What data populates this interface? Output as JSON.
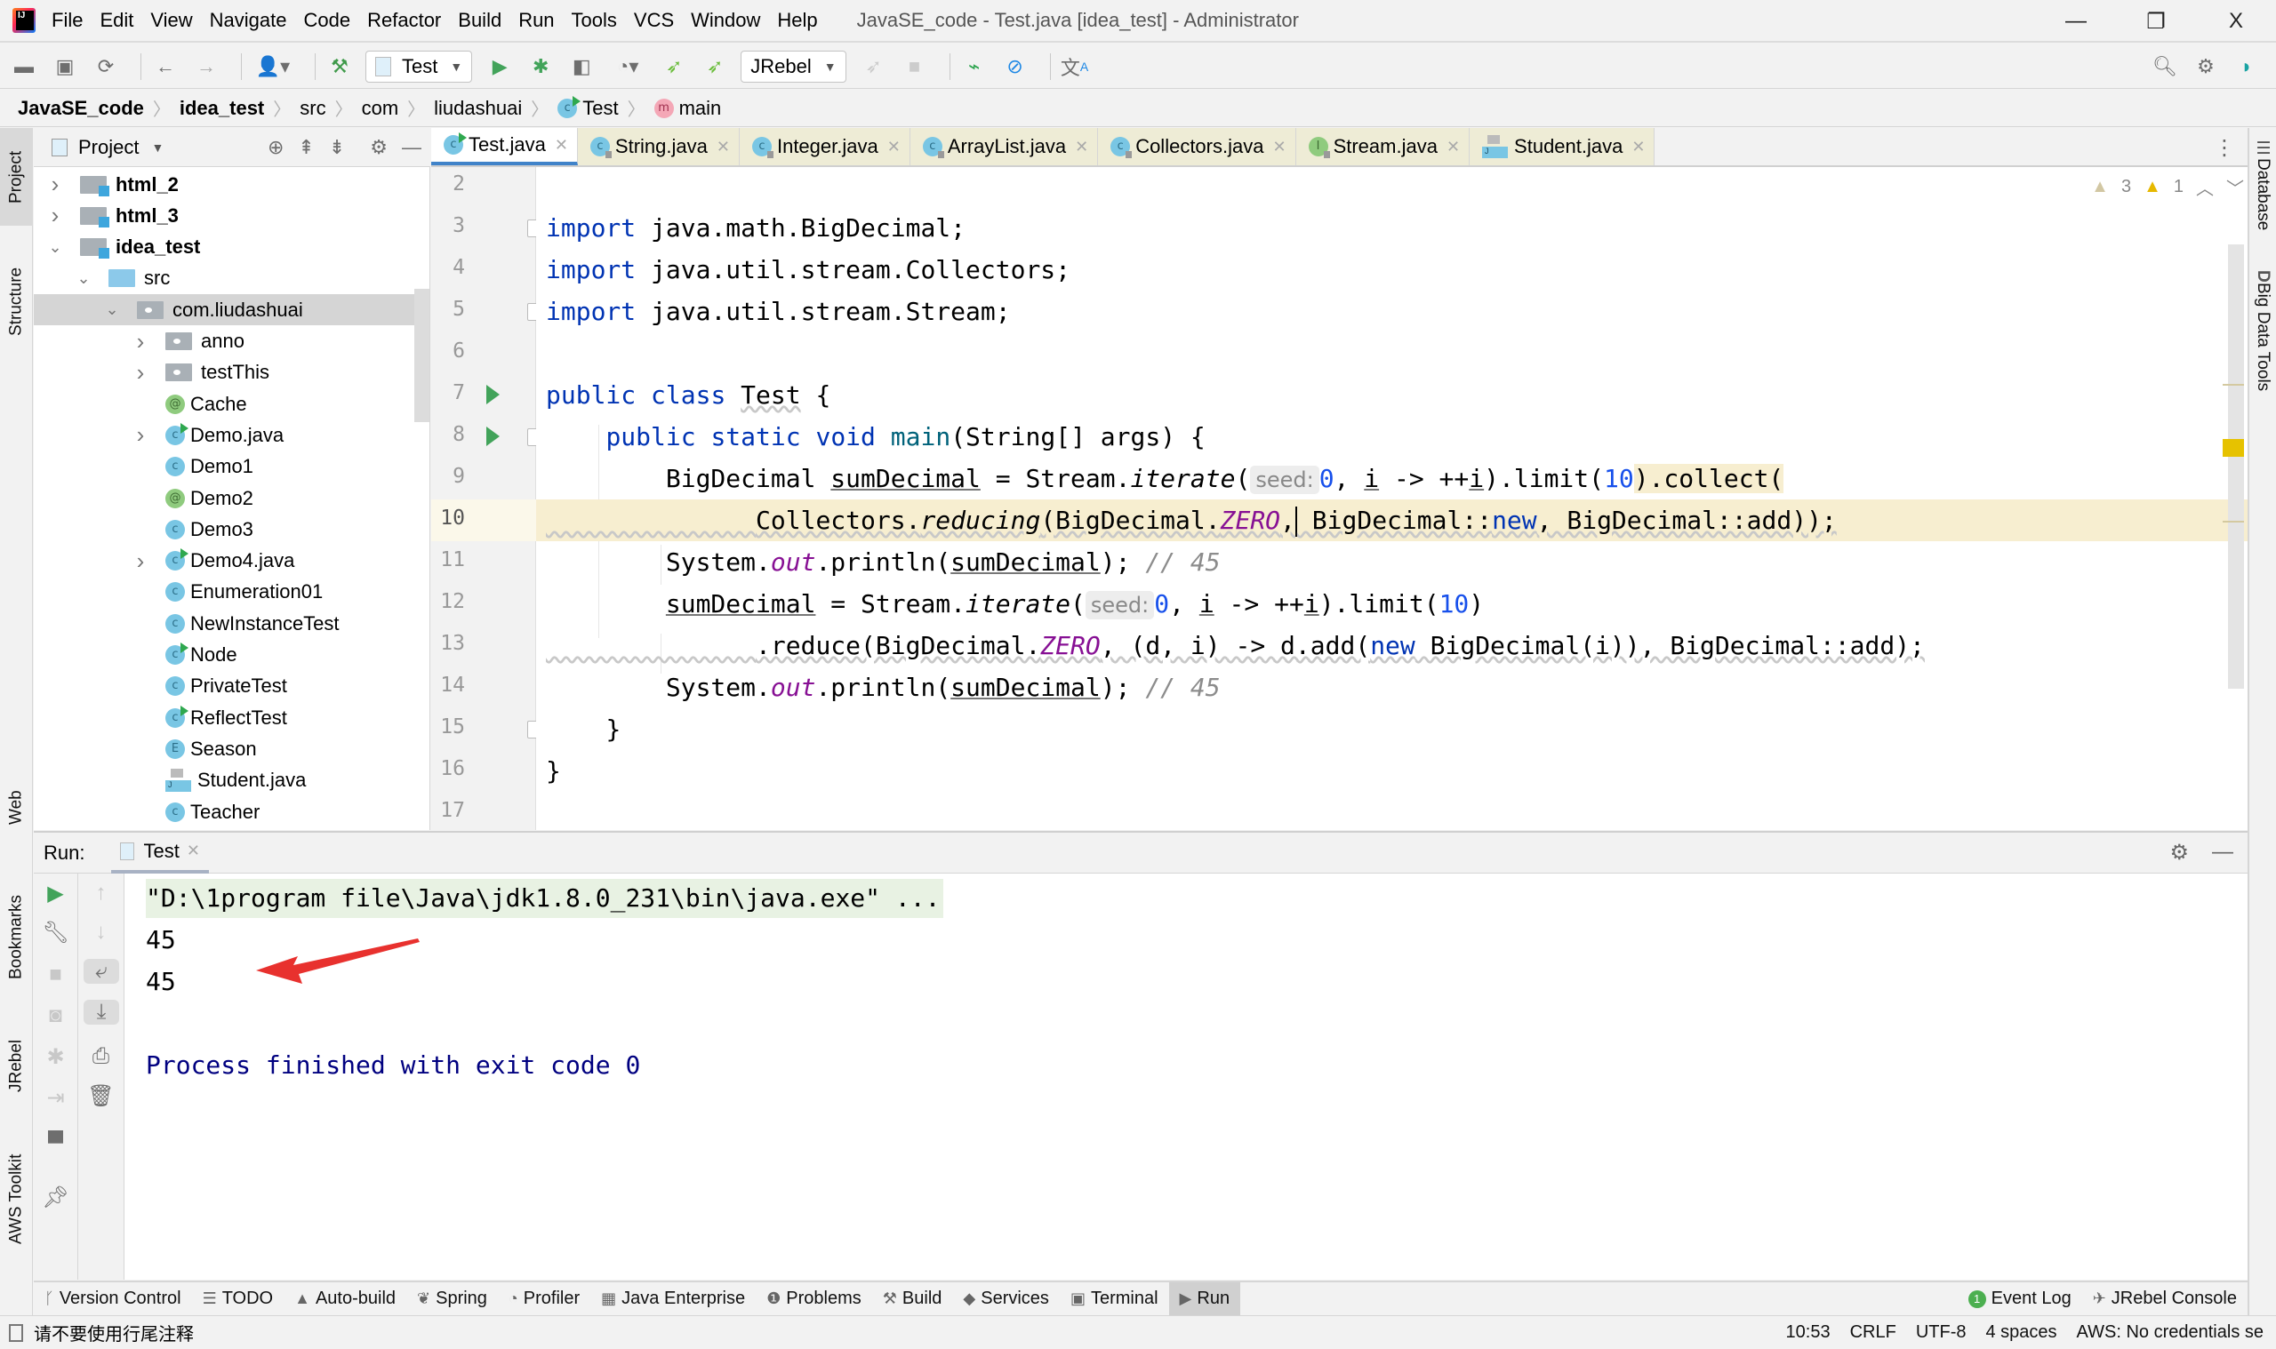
{
  "window": {
    "title": "JavaSE_code - Test.java [idea_test] - Administrator",
    "controls": {
      "minimize": "—",
      "restore": "❐",
      "close": "X"
    }
  },
  "menu": [
    "File",
    "Edit",
    "View",
    "Navigate",
    "Code",
    "Refactor",
    "Build",
    "Run",
    "Tools",
    "VCS",
    "Window",
    "Help"
  ],
  "toolbar": {
    "run_config": "Test",
    "jrebel_config": "JRebel"
  },
  "breadcrumb": [
    "JavaSE_code",
    "idea_test",
    "src",
    "com",
    "liudashuai",
    "Test",
    "main"
  ],
  "left_strip": {
    "project": "Project",
    "structure": "Structure",
    "web": "Web",
    "bookmarks": "Bookmarks",
    "jrebel": "JRebel",
    "aws": "AWS Toolkit"
  },
  "right_strip": {
    "database": "Database",
    "bigdata": "Big Data Tools"
  },
  "project_panel": {
    "title": "Project",
    "tree": [
      {
        "label": "html_2",
        "type": "module",
        "expand": "collapsed",
        "depth": 0
      },
      {
        "label": "html_3",
        "type": "module",
        "expand": "collapsed",
        "depth": 0
      },
      {
        "label": "idea_test",
        "type": "module",
        "expand": "expanded",
        "depth": 0
      },
      {
        "label": "src",
        "type": "src",
        "expand": "expanded",
        "depth": 1
      },
      {
        "label": "com.liudashuai",
        "type": "pkg",
        "expand": "expanded",
        "depth": 2,
        "selected": true
      },
      {
        "label": "anno",
        "type": "pkg",
        "expand": "collapsed",
        "depth": 3
      },
      {
        "label": "testThis",
        "type": "pkg",
        "expand": "collapsed",
        "depth": 3
      },
      {
        "label": "Cache",
        "type": "annotation",
        "expand": "none",
        "depth": 3
      },
      {
        "label": "Demo.java",
        "type": "class-run",
        "expand": "collapsed",
        "depth": 3
      },
      {
        "label": "Demo1",
        "type": "class",
        "expand": "none",
        "depth": 3
      },
      {
        "label": "Demo2",
        "type": "annotation",
        "expand": "none",
        "depth": 3
      },
      {
        "label": "Demo3",
        "type": "class",
        "expand": "none",
        "depth": 3
      },
      {
        "label": "Demo4.java",
        "type": "class-run",
        "expand": "collapsed",
        "depth": 3
      },
      {
        "label": "Enumeration01",
        "type": "class",
        "expand": "none",
        "depth": 3
      },
      {
        "label": "NewInstanceTest",
        "type": "class",
        "expand": "none",
        "depth": 3
      },
      {
        "label": "Node",
        "type": "class-run",
        "expand": "none",
        "depth": 3
      },
      {
        "label": "PrivateTest",
        "type": "class",
        "expand": "none",
        "depth": 3
      },
      {
        "label": "ReflectTest",
        "type": "class-run",
        "expand": "none",
        "depth": 3
      },
      {
        "label": "Season",
        "type": "enum",
        "expand": "none",
        "depth": 3
      },
      {
        "label": "Student.java",
        "type": "javafile",
        "expand": "none",
        "depth": 3
      },
      {
        "label": "Teacher",
        "type": "class",
        "expand": "none",
        "depth": 3
      }
    ]
  },
  "editor_tabs": [
    {
      "label": "Test.java",
      "icon": "class-run",
      "active": true
    },
    {
      "label": "String.java",
      "icon": "class-lock"
    },
    {
      "label": "Integer.java",
      "icon": "class-lock"
    },
    {
      "label": "ArrayList.java",
      "icon": "class-lock"
    },
    {
      "label": "Collectors.java",
      "icon": "class-lock"
    },
    {
      "label": "Stream.java",
      "icon": "interface-lock"
    },
    {
      "label": "Student.java",
      "icon": "javafile"
    }
  ],
  "inspections": {
    "weak_warnings": "3",
    "warnings": "1"
  },
  "editor": {
    "line_numbers": [
      "2",
      "3",
      "4",
      "5",
      "6",
      "7",
      "8",
      "9",
      "10",
      "11",
      "12",
      "13",
      "14",
      "15",
      "16",
      "17"
    ],
    "current_line": "10",
    "tokens": {
      "import": "import",
      "imp1": " java.math.BigDecimal;",
      "imp2": " java.util.stream.Collectors;",
      "imp3": " java.util.stream.Stream;",
      "public": "public",
      "class": "class",
      "static": "static",
      "void": "void",
      "new": "new",
      "class_name": "Test",
      "brace_open": " {",
      "main_sig": "(String[] args) {",
      "main": "main",
      "bigdecimal": "BigDecimal",
      "sumDecimal": "sumDecimal",
      "eq_stream": " = Stream.",
      "iterate": "iterate",
      "paren": "(",
      "seed_hint": "seed:",
      "zero": "0",
      "comma_sp": ", ",
      "i": "i",
      "arrow_inc": " -> ++",
      "limit_open": ").limit(",
      "ten": "10",
      "collect": ").collect(",
      "limit_close": ")",
      "collectors": "Collectors.",
      "reducing": "reducing",
      "bd_dot": "(BigDecimal.",
      "ZERO": "ZERO",
      "comma": ",",
      "bd_new_pre": " BigDecimal::",
      "bd_add_end": ", BigDecimal::add));",
      "system": "System.",
      "out": "out",
      "println": ".println(",
      "println_end": ");",
      "comment45": " // 45",
      "reduce_pre": ".reduce(BigDecimal.",
      "reduce_mid": ", (d, i) -> d.add(",
      "reduce_end": " BigDecimal(i)), BigDecimal::add);",
      "close_brace": "}"
    }
  },
  "run_panel": {
    "label": "Run:",
    "tab": "Test",
    "output": [
      "\"D:\\1program file\\Java\\jdk1.8.0_231\\bin\\java.exe\" ...",
      "45",
      "45",
      "",
      "Process finished with exit code 0"
    ]
  },
  "bottom_tabs": [
    {
      "label": "Version Control",
      "icon": "ᚴ"
    },
    {
      "label": "TODO",
      "icon": "☰"
    },
    {
      "label": "Auto-build",
      "icon": "▲"
    },
    {
      "label": "Spring",
      "icon": "❦"
    },
    {
      "label": "Profiler",
      "icon": "◔"
    },
    {
      "label": "Java Enterprise",
      "icon": "▦"
    },
    {
      "label": "Problems",
      "icon": "❶"
    },
    {
      "label": "Build",
      "icon": "⚒"
    },
    {
      "label": "Services",
      "icon": "◆"
    },
    {
      "label": "Terminal",
      "icon": "▣"
    },
    {
      "label": "Run",
      "icon": "▶",
      "active": true
    }
  ],
  "bottom_right_tabs": [
    {
      "label": "Event Log",
      "badge": "1"
    },
    {
      "label": "JRebel Console",
      "icon": "✈"
    }
  ],
  "status": {
    "message": "请不要使用行尾注释",
    "position": "10:53",
    "line_sep": "CRLF",
    "encoding": "UTF-8",
    "indent": "4 spaces",
    "aws": "AWS: No credentials se"
  },
  "colors": {
    "keyword": "#0033b3",
    "number": "#1750eb",
    "static_field": "#871094",
    "comment": "#8c8c8c",
    "exit_text": "#000080",
    "highlight_line": "#f7eed0",
    "run_green": "#42a35a",
    "active_tab_underline": "#4083c9",
    "annotation_arrow": "#e8312e"
  }
}
